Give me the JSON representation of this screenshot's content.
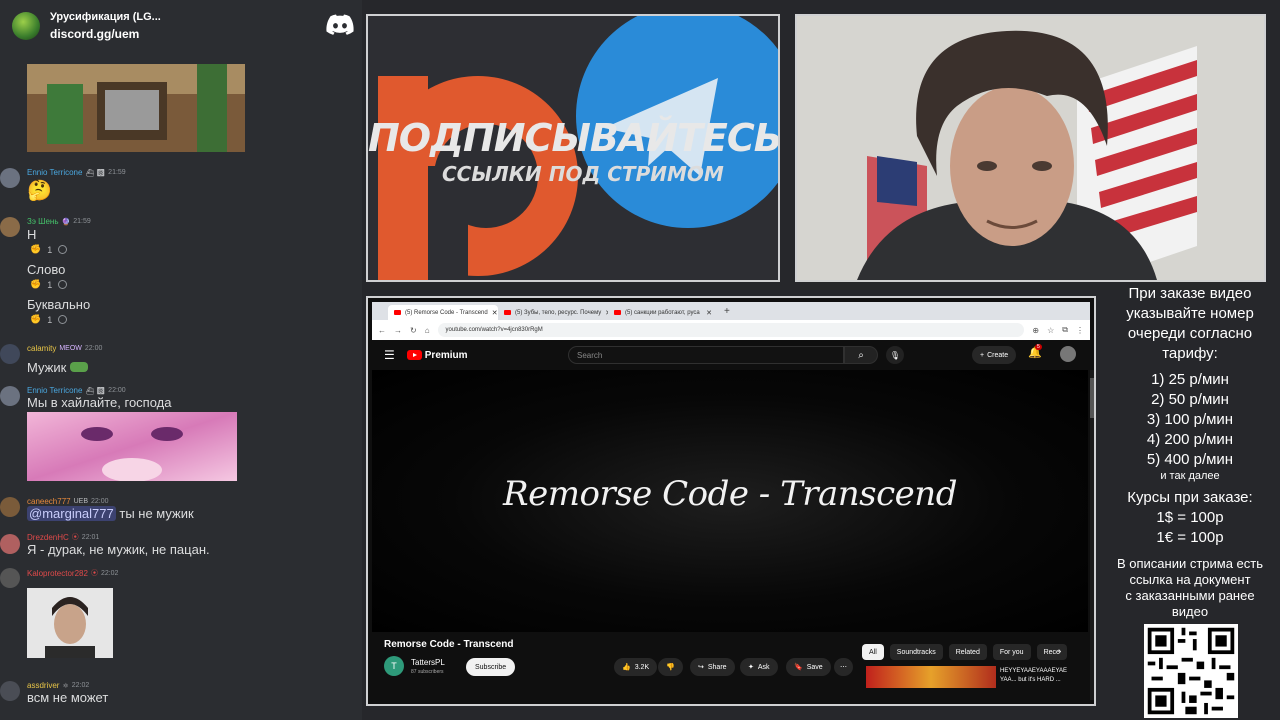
{
  "discord": {
    "server_name": "Урусификация (LG...",
    "server_invite": "discord.gg/uem",
    "messages": [
      {
        "author": "Ennio Terricone",
        "author_color": "#4aa8e0",
        "time": "21:59",
        "text": "🤔"
      },
      {
        "author": "Зэ Шень",
        "author_color": "#45c46b",
        "time": "21:59",
        "lines": [
          "Н",
          "Слово",
          "Буквально"
        ],
        "reaction_count": "1"
      },
      {
        "author": "calamity",
        "author_color": "#e8c547",
        "badge": "MEOW",
        "time": "22:00",
        "text": "Мужик"
      },
      {
        "author": "Ennio Terricone",
        "author_color": "#4aa8e0",
        "time": "22:00",
        "text": "Мы в хайлайте, господа"
      },
      {
        "author": "caneech777",
        "author_color": "#e88a3c",
        "badge": "UEB",
        "time": "22:00",
        "mention": "@marginal777",
        "text": "ты не мужик"
      },
      {
        "author": "DrezdenHC",
        "author_color": "#e04a4a",
        "time": "22:01",
        "text": "Я - дурак, не мужик, не пацан."
      },
      {
        "author": "Kaloprotector282",
        "author_color": "#e04a4a",
        "time": "22:02"
      },
      {
        "author": "assdriver",
        "author_color": "#e8c547",
        "time": "22:02",
        "text": "всм не может"
      }
    ]
  },
  "promo": {
    "title": "ПОДПИСЫВАЙТЕСЬ",
    "subtitle": "ССЫЛКИ ПОД СТРИМОМ"
  },
  "browser": {
    "tabs": [
      "(5) Remorse Code - Transcend",
      "(5) Зубы, тело, ресурс. Почему",
      "(5) санкции работают, руса"
    ],
    "url": "youtube.com/watch?v=4jcn830rRgM",
    "youtube": {
      "brand": "Premium",
      "search_placeholder": "Search",
      "create_label": "Create",
      "notif_count": "5",
      "video_overlay_title": "Remorse Code - Transcend",
      "video_title": "Remorse Code - Transcend",
      "channel_initial": "T",
      "channel_name": "TattersPL",
      "channel_subs": "87 subscribers",
      "subscribe_label": "Subscribe",
      "likes": "3.2K",
      "share_label": "Share",
      "ask_label": "Ask",
      "save_label": "Save",
      "chips": [
        "All",
        "Soundtracks",
        "Related",
        "For you",
        "Rece"
      ],
      "rec_title": "HEYYEYAAEYAAAEYAE YAA... but it's HARD ..."
    }
  },
  "info": {
    "order_text": [
      "При заказе видео",
      "указывайте номер",
      "очереди согласно",
      "тарифу:"
    ],
    "tariffs": [
      "1) 25 р/мин",
      "2) 50 р/мин",
      "3) 100 р/мин",
      "4) 200 р/мин",
      "5) 400 р/мин"
    ],
    "and_more": "и так далее",
    "rates_title": "Курсы при заказе:",
    "rates": [
      "1$ = 100р",
      "1€ = 100р"
    ],
    "desc_text": [
      "В описании стрима есть",
      "ссылка на документ",
      "с заказанными ранее",
      "видео"
    ]
  },
  "colors": {
    "discord_bg": "#2b2d31",
    "youtube_red": "#ff0000",
    "telegram_blue": "#2a8bd8",
    "patreon_orange": "#e0592e"
  }
}
